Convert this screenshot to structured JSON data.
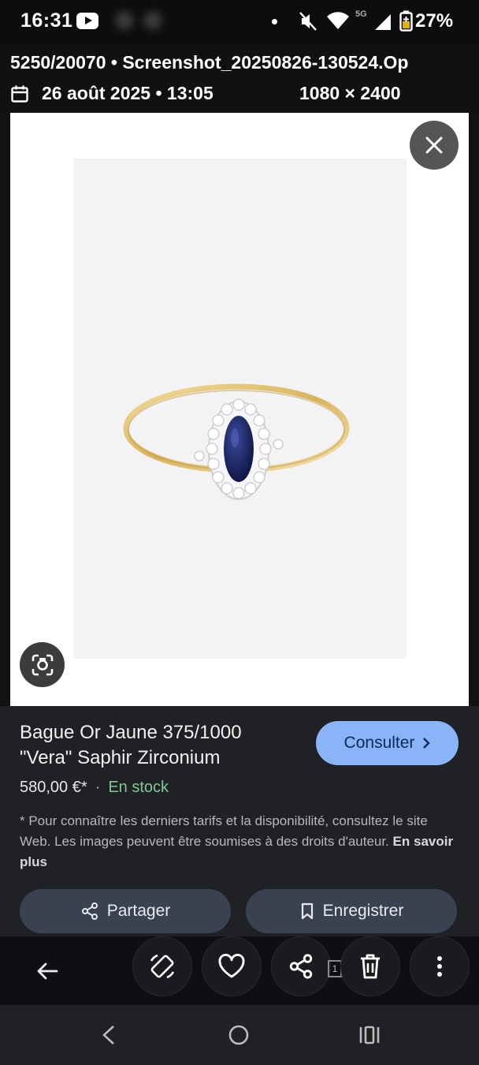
{
  "status_bar": {
    "time": "16:31",
    "network": "5G",
    "battery": "27%"
  },
  "image_header": {
    "title": "5250/20070 • Screenshot_20250826-130524.Op",
    "date": "26 août 2025 • 13:05",
    "dimensions": "1080 × 2400"
  },
  "product": {
    "name": "Bague Or Jaune 375/1000 \"Vera\" Saphir Zirconium",
    "price": "580,00 €*",
    "separator": "·",
    "availability": "En stock",
    "consult_label": "Consulter",
    "disclaimer": "* Pour connaître les derniers tarifs et la disponibilité, consultez le site Web. Les images peuvent être soumises à des droits d'auteur.",
    "learn_more": "En savoir plus"
  },
  "actions": {
    "share_label": "Partager",
    "save_label": "Enregistrer"
  },
  "toolbar": {
    "badge": "1"
  },
  "colors": {
    "accent": "#8ab4f8",
    "stock": "#81c995",
    "panel": "#1f2125"
  }
}
